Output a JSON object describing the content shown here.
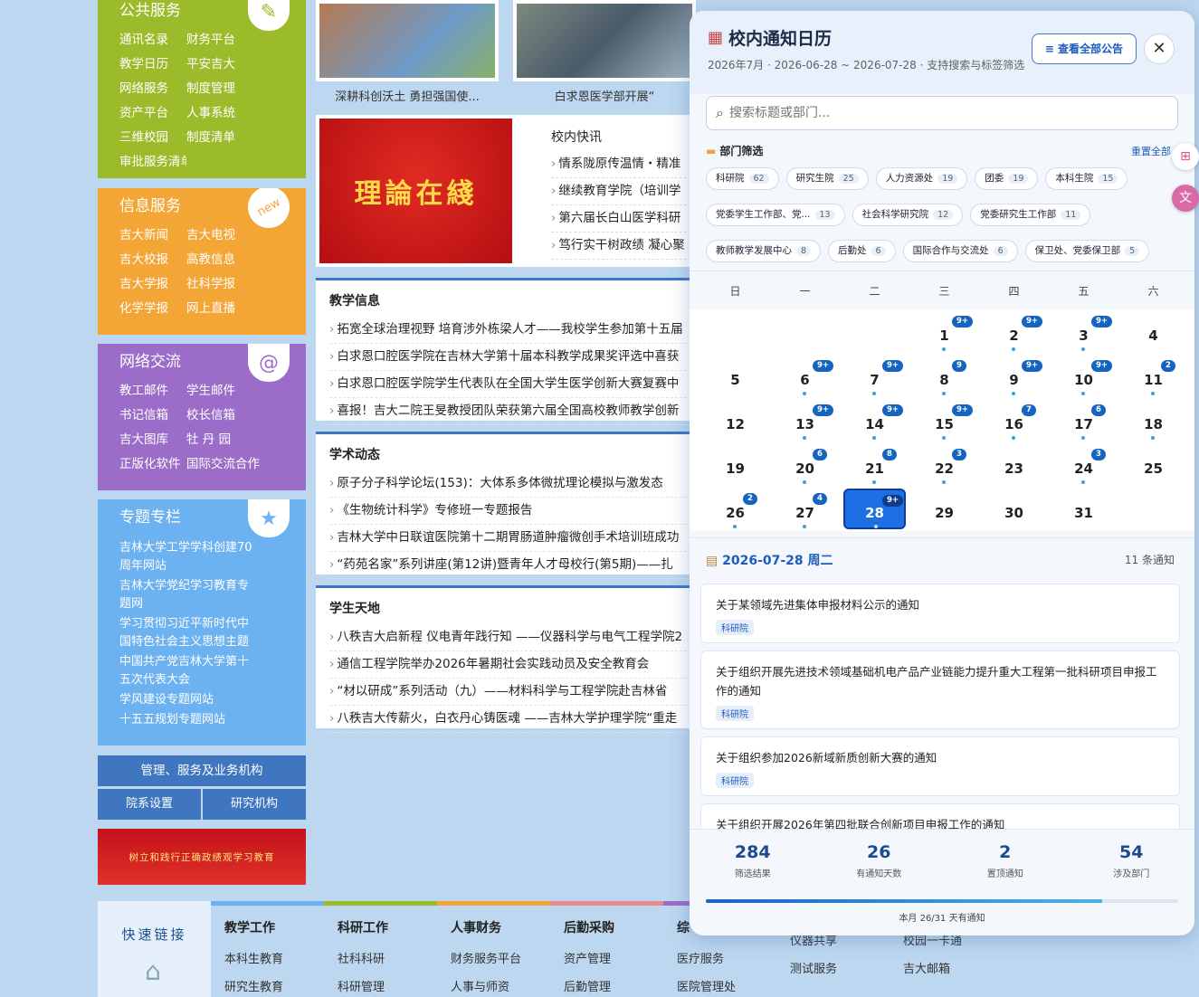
{
  "left": {
    "public": {
      "title": "公共服务",
      "icon": "pencil-icon",
      "links": [
        "通讯名录",
        "财务平台",
        "教学日历",
        "平安吉大",
        "网络服务",
        "制度管理",
        "资产平台",
        "人事系统",
        "三维校园",
        "制度清单",
        "审批服务清单"
      ]
    },
    "info": {
      "title": "信息服务",
      "icon": "new-badge-icon",
      "badge": "new",
      "links": [
        "吉大新闻",
        "吉大电视",
        "吉大校报",
        "高教信息",
        "吉大学报",
        "社科学报",
        "化学学报",
        "网上直播"
      ]
    },
    "net": {
      "title": "网络交流",
      "icon": "at-icon",
      "links": [
        "教工邮件",
        "学生邮件",
        "书记信箱",
        "校长信箱",
        "吉大图库",
        "牡 丹 园",
        "正版化软件",
        "国际交流合作"
      ]
    },
    "topics": {
      "title": "专题专栏",
      "icon": "ribbon-icon",
      "links": [
        "吉林大学工学学科创建70周年网站",
        "吉林大学党纪学习教育专题网",
        "学习贯彻习近平新时代中国特色社会主义思想主题",
        "中国共产党吉林大学第十五次代表大会",
        "学风建设专题网站",
        "十五五规划专题网站"
      ]
    },
    "bar1": "管理、服务及业务机构",
    "bar2": [
      "院系设置",
      "研究机构"
    ],
    "banner": "树立和践行正确政绩观学习教育"
  },
  "mid": {
    "captions": [
      "深耕科创沃土 勇担强国使...",
      "白求恩医学部开展“"
    ],
    "red_img_text": "理論在綫",
    "quick": {
      "title": "校内快讯",
      "items": [
        "情系陇原传温情・精准",
        "继续教育学院（培训学",
        "第六届长白山医学科研",
        "笃行实干树政绩 凝心聚"
      ]
    },
    "sections": [
      {
        "title": "教学信息",
        "items": [
          "拓宽全球治理视野 培育涉外栋梁人才——我校学生参加第十五届",
          "白求恩口腔医学院在吉林大学第十届本科教学成果奖评选中喜获",
          "白求恩口腔医学院学生代表队在全国大学生医学创新大赛复赛中",
          "喜报！吉大二院王旻教授团队荣获第六届全国高校教师教学创新"
        ]
      },
      {
        "title": "学术动态",
        "items": [
          "原子分子科学论坛(153)：大体系多体微扰理论模拟与激发态",
          "《生物统计科学》专修班一专题报告",
          "吉林大学中日联谊医院第十二期胃肠道肿瘤微创手术培训班成功",
          "“药苑名家”系列讲座(第12讲)暨青年人才母校行(第5期)——扎"
        ]
      },
      {
        "title": "学生天地",
        "items": [
          "八秩吉大启新程 仪电青年践行知 ——仪器科学与电气工程学院2",
          "通信工程学院举办2026年暑期社会实践动员及安全教育会",
          "“材以研成”系列活动（九）——材料科学与工程学院赴吉林省",
          "八秩吉大传薪火，白衣丹心铸医魂 ——吉林大学护理学院“重走"
        ]
      }
    ]
  },
  "footer": {
    "label": "快速链接",
    "cols": [
      {
        "h": "教学工作",
        "items": [
          "本科生教育",
          "研究生教育"
        ]
      },
      {
        "h": "科研工作",
        "items": [
          "社科科研",
          "科研管理"
        ]
      },
      {
        "h": "人事财务",
        "items": [
          "财务服务平台",
          "人事与师资"
        ]
      },
      {
        "h": "后勤采购",
        "items": [
          "资产管理",
          "后勤管理"
        ]
      },
      {
        "h": "综",
        "items": [
          "医疗服务",
          "医院管理处"
        ]
      },
      {
        "h": "",
        "items": [
          "仪器共享",
          "测试服务"
        ]
      },
      {
        "h": "",
        "items": [
          "校园一卡通",
          "吉大邮箱"
        ]
      }
    ]
  },
  "panel": {
    "title": "校内通知日历",
    "title_icon": "calendar-icon",
    "subtitle": "2026年7月 · 2026-06-28 ~ 2026-07-28 · 支持搜索与标签筛选",
    "view_all": "≡ 查看全部公告",
    "close": "✕",
    "search_placeholder": "搜索标题或部门...",
    "filter_title": "部门筛选",
    "reset": "重置全部",
    "chips": [
      {
        "name": "科研院",
        "count": "62"
      },
      {
        "name": "研究生院",
        "count": "25"
      },
      {
        "name": "人力资源处",
        "count": "19"
      },
      {
        "name": "团委",
        "count": "19"
      },
      {
        "name": "本科生院",
        "count": "15"
      },
      {
        "name": "党委学生工作部、党...",
        "count": "13"
      },
      {
        "name": "社会科学研究院",
        "count": "12"
      },
      {
        "name": "党委研究生工作部",
        "count": "11"
      },
      {
        "name": "教师教学发展中心",
        "count": "8"
      },
      {
        "name": "后勤处",
        "count": "6"
      },
      {
        "name": "国际合作与交流处",
        "count": "6"
      },
      {
        "name": "保卫处、党委保卫部",
        "count": "5"
      }
    ],
    "weekdays": [
      "日",
      "一",
      "二",
      "三",
      "四",
      "五",
      "六"
    ],
    "days": [
      {
        "d": "",
        "b": "",
        "dot": false
      },
      {
        "d": "",
        "b": "",
        "dot": false
      },
      {
        "d": "",
        "b": "",
        "dot": false
      },
      {
        "d": "1",
        "b": "9+",
        "dot": true
      },
      {
        "d": "2",
        "b": "9+",
        "dot": true
      },
      {
        "d": "3",
        "b": "9+",
        "dot": true
      },
      {
        "d": "4",
        "b": "",
        "dot": false
      },
      {
        "d": "5",
        "b": "",
        "dot": false
      },
      {
        "d": "6",
        "b": "9+",
        "dot": true
      },
      {
        "d": "7",
        "b": "9+",
        "dot": true
      },
      {
        "d": "8",
        "b": "9",
        "dot": true
      },
      {
        "d": "9",
        "b": "9+",
        "dot": true
      },
      {
        "d": "10",
        "b": "9+",
        "dot": true
      },
      {
        "d": "11",
        "b": "2",
        "dot": true
      },
      {
        "d": "12",
        "b": "",
        "dot": false
      },
      {
        "d": "13",
        "b": "9+",
        "dot": true
      },
      {
        "d": "14",
        "b": "9+",
        "dot": true
      },
      {
        "d": "15",
        "b": "9+",
        "dot": true
      },
      {
        "d": "16",
        "b": "7",
        "dot": true
      },
      {
        "d": "17",
        "b": "6",
        "dot": true
      },
      {
        "d": "18",
        "b": "",
        "dot": true
      },
      {
        "d": "19",
        "b": "",
        "dot": false
      },
      {
        "d": "20",
        "b": "6",
        "dot": true
      },
      {
        "d": "21",
        "b": "8",
        "dot": true
      },
      {
        "d": "22",
        "b": "3",
        "dot": true
      },
      {
        "d": "23",
        "b": "",
        "dot": false
      },
      {
        "d": "24",
        "b": "3",
        "dot": true
      },
      {
        "d": "25",
        "b": "",
        "dot": false
      },
      {
        "d": "26",
        "b": "2",
        "dot": true
      },
      {
        "d": "27",
        "b": "4",
        "dot": true
      },
      {
        "d": "28",
        "b": "9+",
        "dot": true,
        "sel": true
      },
      {
        "d": "29",
        "b": "",
        "dot": false
      },
      {
        "d": "30",
        "b": "",
        "dot": false
      },
      {
        "d": "31",
        "b": "",
        "dot": false
      }
    ],
    "day_title": "2026-07-28 周二",
    "day_count": "11 条通知",
    "notices": [
      {
        "text": "关于某领域先进集体申报材料公示的通知",
        "tag": "科研院"
      },
      {
        "text": "关于组织开展先进技术领域基础机电产品产业链能力提升重大工程第一批科研项目申报工作的通知",
        "tag": "科研院"
      },
      {
        "text": "关于组织参加2026新域新质创新大赛的通知",
        "tag": "科研院"
      },
      {
        "text": "关于组织开展2026年第四批联合创新项目申报工作的通知",
        "tag": "科研院"
      }
    ],
    "stats": [
      {
        "v": "284",
        "l": "筛选结果"
      },
      {
        "v": "26",
        "l": "有通知天数"
      },
      {
        "v": "2",
        "l": "置顶通知"
      },
      {
        "v": "54",
        "l": "涉及部门"
      }
    ],
    "progress": 0.8387,
    "progress_note": "本月 26/31 天有通知",
    "colors": {
      "accent": "#1f6fe4",
      "badge": "#1565c0"
    }
  }
}
